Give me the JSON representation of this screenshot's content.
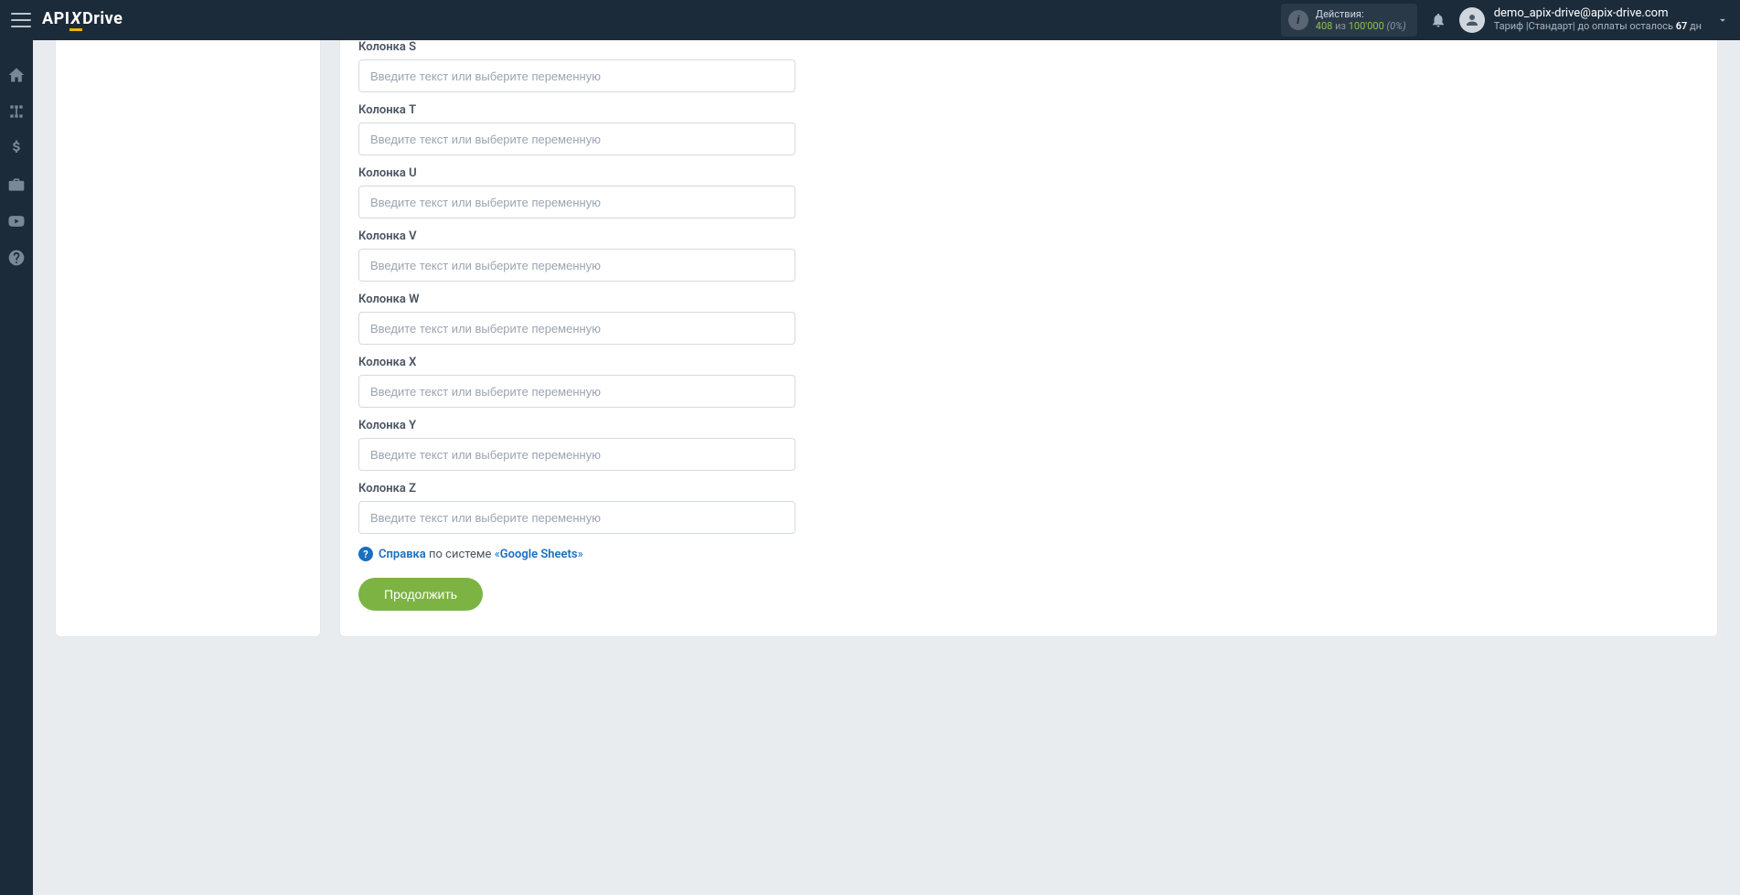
{
  "header": {
    "logo": {
      "api": "API",
      "x": "X",
      "drive": "Drive"
    },
    "actions": {
      "label": "Действия:",
      "count": "408",
      "of": "из",
      "total": "100'000",
      "pct": "(0%)"
    },
    "user": {
      "email": "demo_apix-drive@apix-drive.com",
      "tariff_prefix": "Тариф |Стандарт| до оплаты осталось ",
      "tariff_days": "67",
      "tariff_suffix": " дн"
    }
  },
  "form": {
    "placeholder": "Введите текст или выберите переменную",
    "fields": [
      {
        "label": "Колонка S"
      },
      {
        "label": "Колонка T"
      },
      {
        "label": "Колонка U"
      },
      {
        "label": "Колонка V"
      },
      {
        "label": "Колонка W"
      },
      {
        "label": "Колонка X"
      },
      {
        "label": "Колонка Y"
      },
      {
        "label": "Колонка Z"
      }
    ],
    "help": {
      "t1": "Справка",
      "t2": " по системе ",
      "t3": "«",
      "t4": "Google Sheets",
      "t5": "»"
    },
    "continue": "Продолжить"
  }
}
